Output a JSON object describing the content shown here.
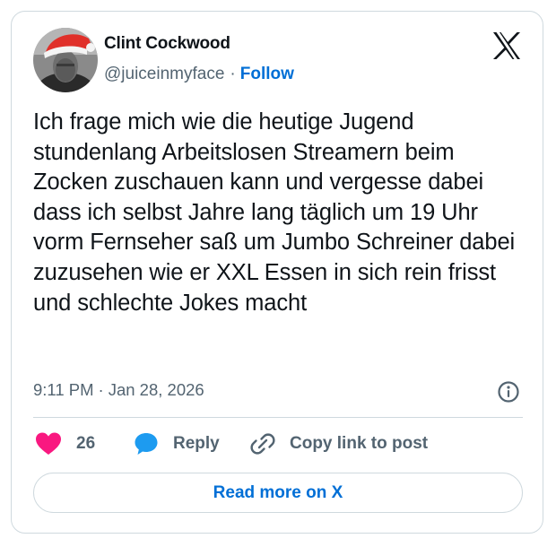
{
  "author": {
    "display_name": "Clint Cockwood",
    "handle": "@juiceinmyface",
    "separator": "·",
    "follow_label": "Follow"
  },
  "tweet": {
    "text": "Ich frage mich wie die heutige Jugend stundenlang Arbeitslosen Streamern beim Zocken zuschauen kann und vergesse dabei dass ich selbst Jahre lang täglich um 19 Uhr vorm Fernseher saß um Jumbo Schreiner dabei zuzusehen wie er XXL Essen in sich rein frisst und schlechte Jokes macht",
    "time": "9:11 PM",
    "separator": "·",
    "date": "Jan 28, 2026"
  },
  "actions": {
    "like_count": "26",
    "reply_label": "Reply",
    "copy_label": "Copy link to post"
  },
  "read_more_label": "Read more on X",
  "icons": {
    "logo": "x-logo-icon",
    "info": "info-icon",
    "like": "heart-icon",
    "reply": "speech-bubble-icon",
    "copy": "link-icon"
  },
  "colors": {
    "link_blue": "#006fd6",
    "heart_pink": "#f91880",
    "reply_blue": "#1d9bf0",
    "muted_text": "#536471",
    "border": "#cfd9de"
  }
}
